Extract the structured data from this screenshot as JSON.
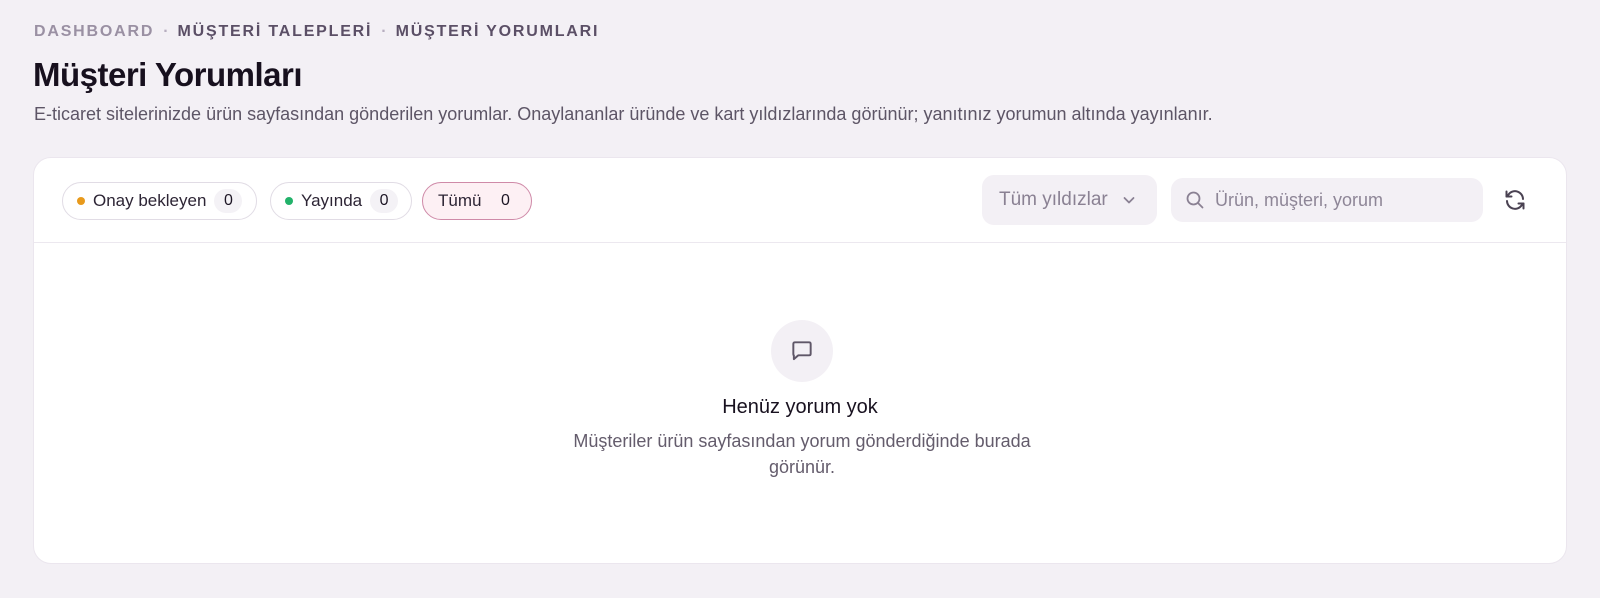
{
  "breadcrumb": [
    "DASHBOARD",
    "MÜŞTERİ TALEPLERİ",
    "MÜŞTERİ YORUMLARI"
  ],
  "page": {
    "title": "Müşteri Yorumları",
    "description": "E-ticaret sitelerinizde ürün sayfasından gönderilen yorumlar. Onaylananlar üründe ve kart yıldızlarında görünür; yanıtınız yorumun altında yayınlanır."
  },
  "filters": {
    "pending": {
      "label": "Onay bekleyen",
      "count": "0",
      "dot_color": "#e89a1c"
    },
    "live": {
      "label": "Yayında",
      "count": "0",
      "dot_color": "#22b26a"
    },
    "all": {
      "label": "Tümü",
      "count": "0"
    }
  },
  "stars_select": {
    "value": "Tüm yıldızlar",
    "icon": "chevron-down-icon"
  },
  "search": {
    "placeholder": "Ürün, müşteri, yorum",
    "value": "",
    "icon": "search-icon"
  },
  "refresh": {
    "icon": "refresh-icon"
  },
  "empty_state": {
    "icon": "message-square-icon",
    "title": "Henüz yorum yok",
    "description": "Müşteriler ürün sayfasından yorum gönderdiğinde burada görünür."
  },
  "colors": {
    "background": "#f3f0f5",
    "accent": "#cf8aa8",
    "card": "#ffffff"
  }
}
